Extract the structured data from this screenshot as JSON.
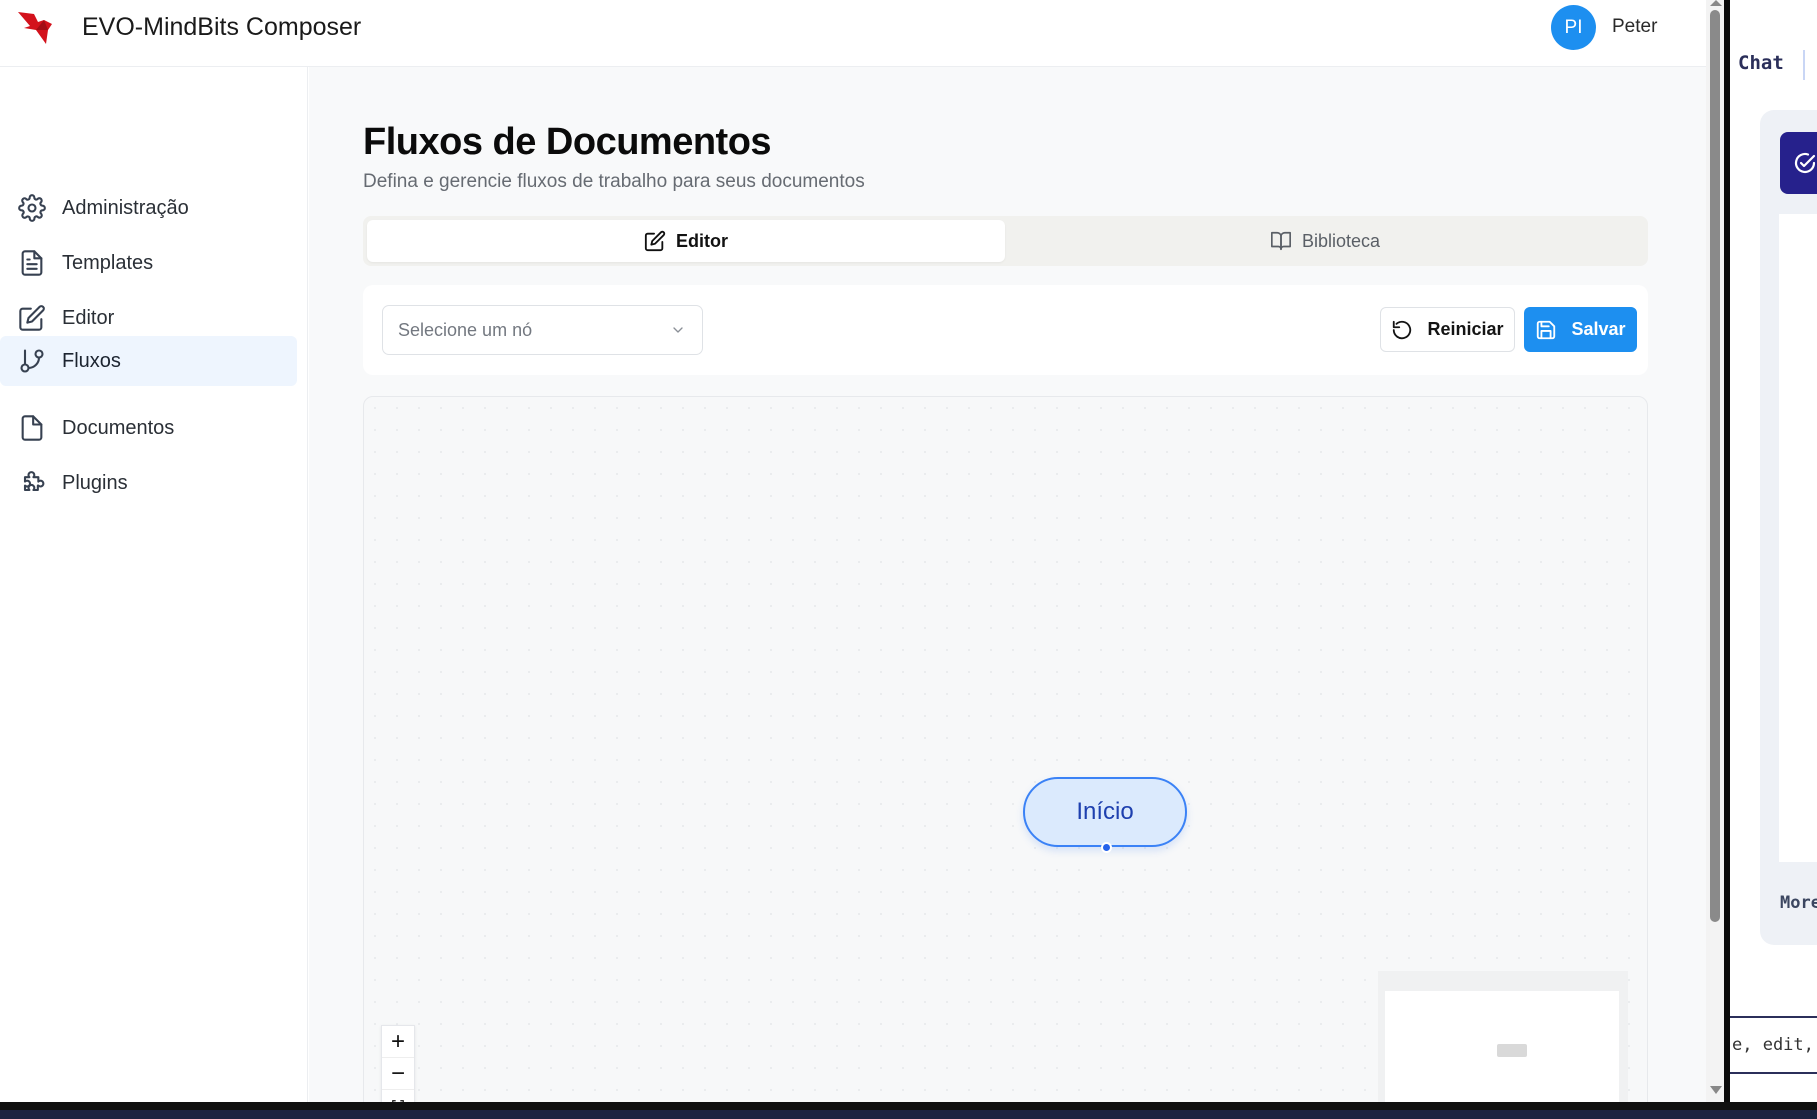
{
  "header": {
    "app_title": "EVO-MindBits Composer",
    "avatar_initials": "PI",
    "user_name": "Peter",
    "brand_color": "#d3121c"
  },
  "sidebar": {
    "items": [
      {
        "label": "Administração",
        "icon": "gear-icon"
      },
      {
        "label": "Templates",
        "icon": "file-text-icon"
      },
      {
        "label": "Editor",
        "icon": "edit-icon"
      },
      {
        "label": "Fluxos",
        "icon": "git-branch-icon",
        "active": true
      },
      {
        "label": "Documentos",
        "icon": "file-icon"
      },
      {
        "label": "Plugins",
        "icon": "puzzle-icon"
      }
    ]
  },
  "main": {
    "title": "Fluxos de Documentos",
    "subtitle": "Defina e gerencie fluxos de trabalho para seus documentos",
    "tabs": [
      {
        "label": "Editor",
        "icon": "edit-icon",
        "active": true
      },
      {
        "label": "Biblioteca",
        "icon": "book-open-icon",
        "active": false
      }
    ],
    "toolbar": {
      "select_placeholder": "Selecione um nó",
      "reset_label": "Reiniciar",
      "save_label": "Salvar"
    },
    "canvas": {
      "start_node_label": "Início",
      "zoom_in": "+",
      "zoom_out": "−"
    }
  },
  "side_panel": {
    "chat_tab": "Chat",
    "more_label": "More",
    "input_text": "e, edit, an"
  },
  "colors": {
    "accent": "#1d8ff0",
    "node_fill": "#dbeafd",
    "node_border": "#3b82f6",
    "active_nav_bg": "#eef5fe"
  }
}
